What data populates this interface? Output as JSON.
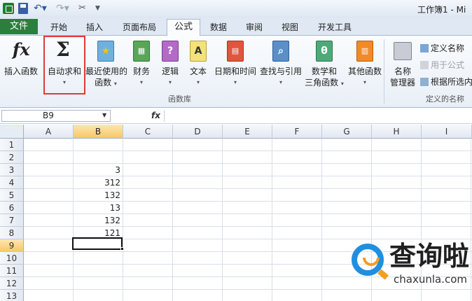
{
  "window": {
    "title": "工作簿1 - Mi"
  },
  "tabs": {
    "file": "文件",
    "home": "开始",
    "insert": "插入",
    "page_layout": "页面布局",
    "formulas": "公式",
    "data": "数据",
    "review": "审阅",
    "view": "视图",
    "developer": "开发工具"
  },
  "ribbon": {
    "insert_function": "插入函数",
    "autosum": "自动求和",
    "recent_1": "最近使用的",
    "recent_2": "函数",
    "financial": "财务",
    "logical": "逻辑",
    "text": "文本",
    "datetime": "日期和时间",
    "lookup": "查找与引用",
    "math_1": "数学和",
    "math_2": "三角函数",
    "other": "其他函数",
    "group_library": "函数库",
    "name_mgr_1": "名称",
    "name_mgr_2": "管理器",
    "define_name": "定义名称",
    "use_in_formula": "用于公式",
    "create_from_sel": "根据所选内",
    "group_defined": "定义的名称",
    "dropdown": "▾"
  },
  "formula_bar": {
    "name_box": "B9",
    "fx": "fx",
    "content": ""
  },
  "grid": {
    "columns": [
      "A",
      "B",
      "C",
      "D",
      "E",
      "F",
      "G",
      "H",
      "I"
    ],
    "rows": [
      "1",
      "2",
      "3",
      "4",
      "5",
      "6",
      "7",
      "8",
      "9",
      "10",
      "11",
      "12",
      "13"
    ],
    "selected_cell": "B9",
    "values": {
      "B3": "3",
      "B4": "312",
      "B5": "132",
      "B6": "13",
      "B7": "132",
      "B8": "121"
    }
  },
  "watermark": {
    "text": "查询啦",
    "url": "chaxunla.com"
  },
  "colors": {
    "file_tab": "#2a7f3c",
    "highlight": "#e03a3a",
    "selection_header": "#f7c768"
  }
}
